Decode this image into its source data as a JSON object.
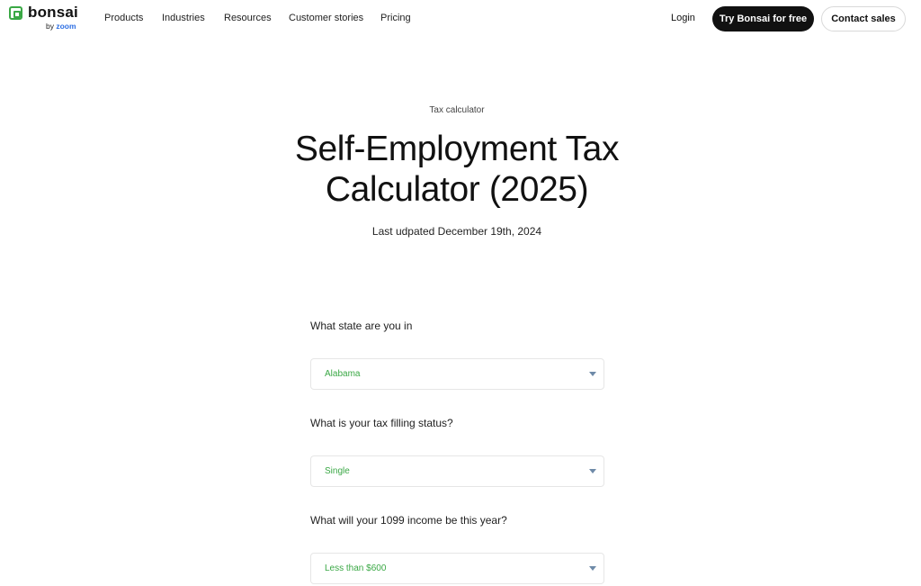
{
  "brand": {
    "name": "bonsai",
    "sub_prefix": "by",
    "sub_brand": "zoom"
  },
  "nav": {
    "links": [
      "Products",
      "Industries",
      "Resources",
      "Customer stories",
      "Pricing"
    ],
    "login": "Login",
    "try_button": "Try Bonsai for free",
    "contact_button": "Contact sales"
  },
  "hero": {
    "eyebrow": "Tax calculator",
    "title_line1": "Self-Employment Tax",
    "title_line2": "Calculator (2025)",
    "updated": "Last udpated December 19th, 2024"
  },
  "form": {
    "state": {
      "question": "What state are you in",
      "value": "Alabama"
    },
    "filing": {
      "question": "What is your tax filling status?",
      "value": "Single"
    },
    "income": {
      "question": "What will your 1099 income be this year?",
      "value": "Less than $600"
    }
  },
  "colors": {
    "accent": "#3aa845",
    "zoom_blue": "#2d6fe3",
    "chevron": "#6e8aa8"
  },
  "icons": {
    "logo": "bonsai-logo-icon",
    "dropdown": "chevron-down-icon"
  }
}
